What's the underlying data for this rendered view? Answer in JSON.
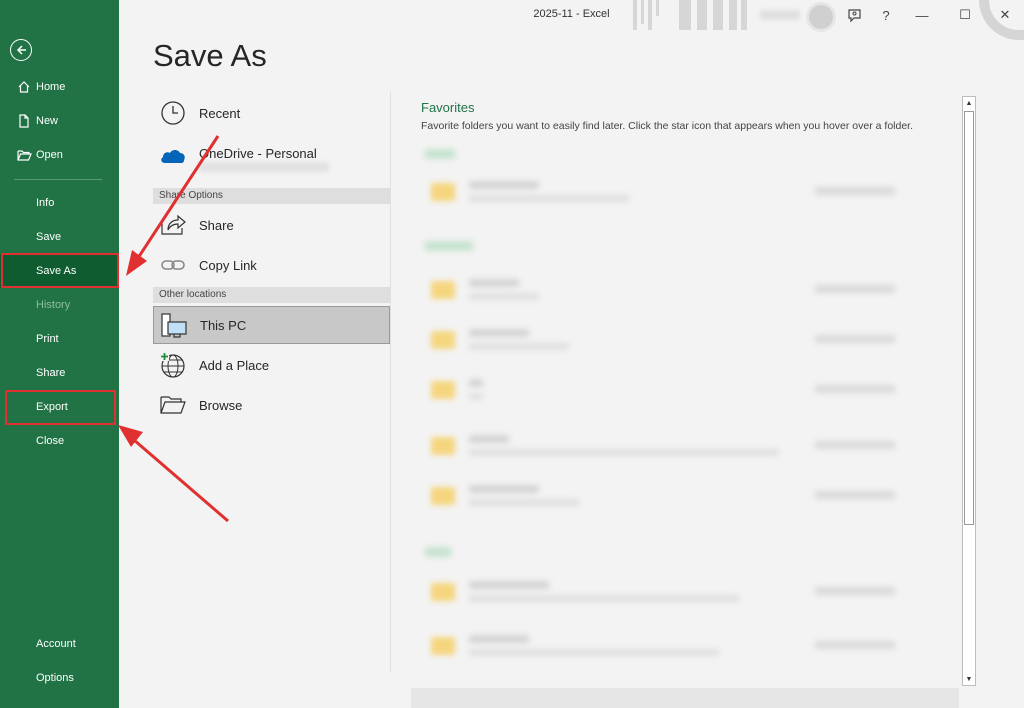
{
  "window": {
    "title": "2025-11  -  Excel",
    "controls": {
      "minimize": "—",
      "maximize": "☐",
      "close": "✕",
      "help": "?"
    }
  },
  "sidebar": {
    "back_icon": "back-arrow-icon",
    "items": [
      {
        "label": "Home",
        "icon": "home-icon"
      },
      {
        "label": "New",
        "icon": "new-document-icon"
      },
      {
        "label": "Open",
        "icon": "open-folder-icon"
      },
      {
        "label": "Info"
      },
      {
        "label": "Save"
      },
      {
        "label": "Save As",
        "selected": true
      },
      {
        "label": "History",
        "disabled": true
      },
      {
        "label": "Print"
      },
      {
        "label": "Share"
      },
      {
        "label": "Export"
      },
      {
        "label": "Close"
      },
      {
        "label": "Account"
      },
      {
        "label": "Options"
      }
    ]
  },
  "main": {
    "title": "Save As",
    "locations": {
      "recent": "Recent",
      "onedrive": "OneDrive - Personal",
      "share_header": "Share Options",
      "share": "Share",
      "copy_link": "Copy Link",
      "other_header": "Other locations",
      "this_pc": "This PC",
      "add_place": "Add a Place",
      "browse": "Browse"
    },
    "favorites": {
      "title": "Favorites",
      "description": "Favorite folders you want to easily find later. Click the star icon that appears when you hover over a folder."
    }
  },
  "colors": {
    "sidebar_bg": "#217346",
    "sidebar_selected": "#0e5c2f",
    "accent_text": "#217346",
    "annotation_red": "#e03030"
  }
}
